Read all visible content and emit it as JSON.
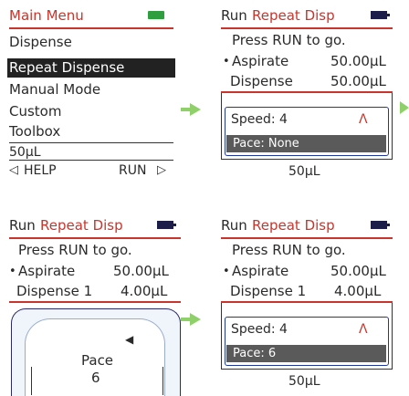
{
  "main_menu": {
    "title": "Main Menu",
    "items": [
      "Dispense",
      "Repeat Dispense",
      "Manual Mode",
      "Custom",
      "Toolbox"
    ],
    "selected_index": 1,
    "volume": "50µL",
    "help": "HELP",
    "run": "RUN"
  },
  "panel_tr": {
    "run": "Run",
    "mode": "Repeat Disp",
    "prompt": "Press RUN to go.",
    "aspirate_label": "Aspirate",
    "aspirate_value": "50.00µL",
    "dispense_label": "Dispense",
    "dispense_value": "50.00µL",
    "speed": "Speed: 4",
    "speed_arrow": "Λ",
    "pace": "Pace: None",
    "volume": "50µL"
  },
  "panel_bl": {
    "run": "Run",
    "mode": "Repeat Disp",
    "prompt": "Press RUN to go.",
    "aspirate_label": "Aspirate",
    "aspirate_value": "50.00µL",
    "dispense_label": "Dispense 1",
    "dispense_value": "4.00µL",
    "pace_label": "Pace",
    "pace_value": "6"
  },
  "panel_br": {
    "run": "Run",
    "mode": "Repeat Disp",
    "prompt": "Press RUN to go.",
    "aspirate_label": "Aspirate",
    "aspirate_value": "50.00µL",
    "dispense_label": "Dispense 1",
    "dispense_value": "4.00µL",
    "speed": "Speed: 4",
    "speed_arrow": "Λ",
    "pace": "Pace: 6",
    "volume": "50µL"
  },
  "colors": {
    "accent_red": "#c8352c",
    "battery_green": "#2e9e3e",
    "arrow_green": "#8fd06a",
    "selection": "#222222"
  }
}
